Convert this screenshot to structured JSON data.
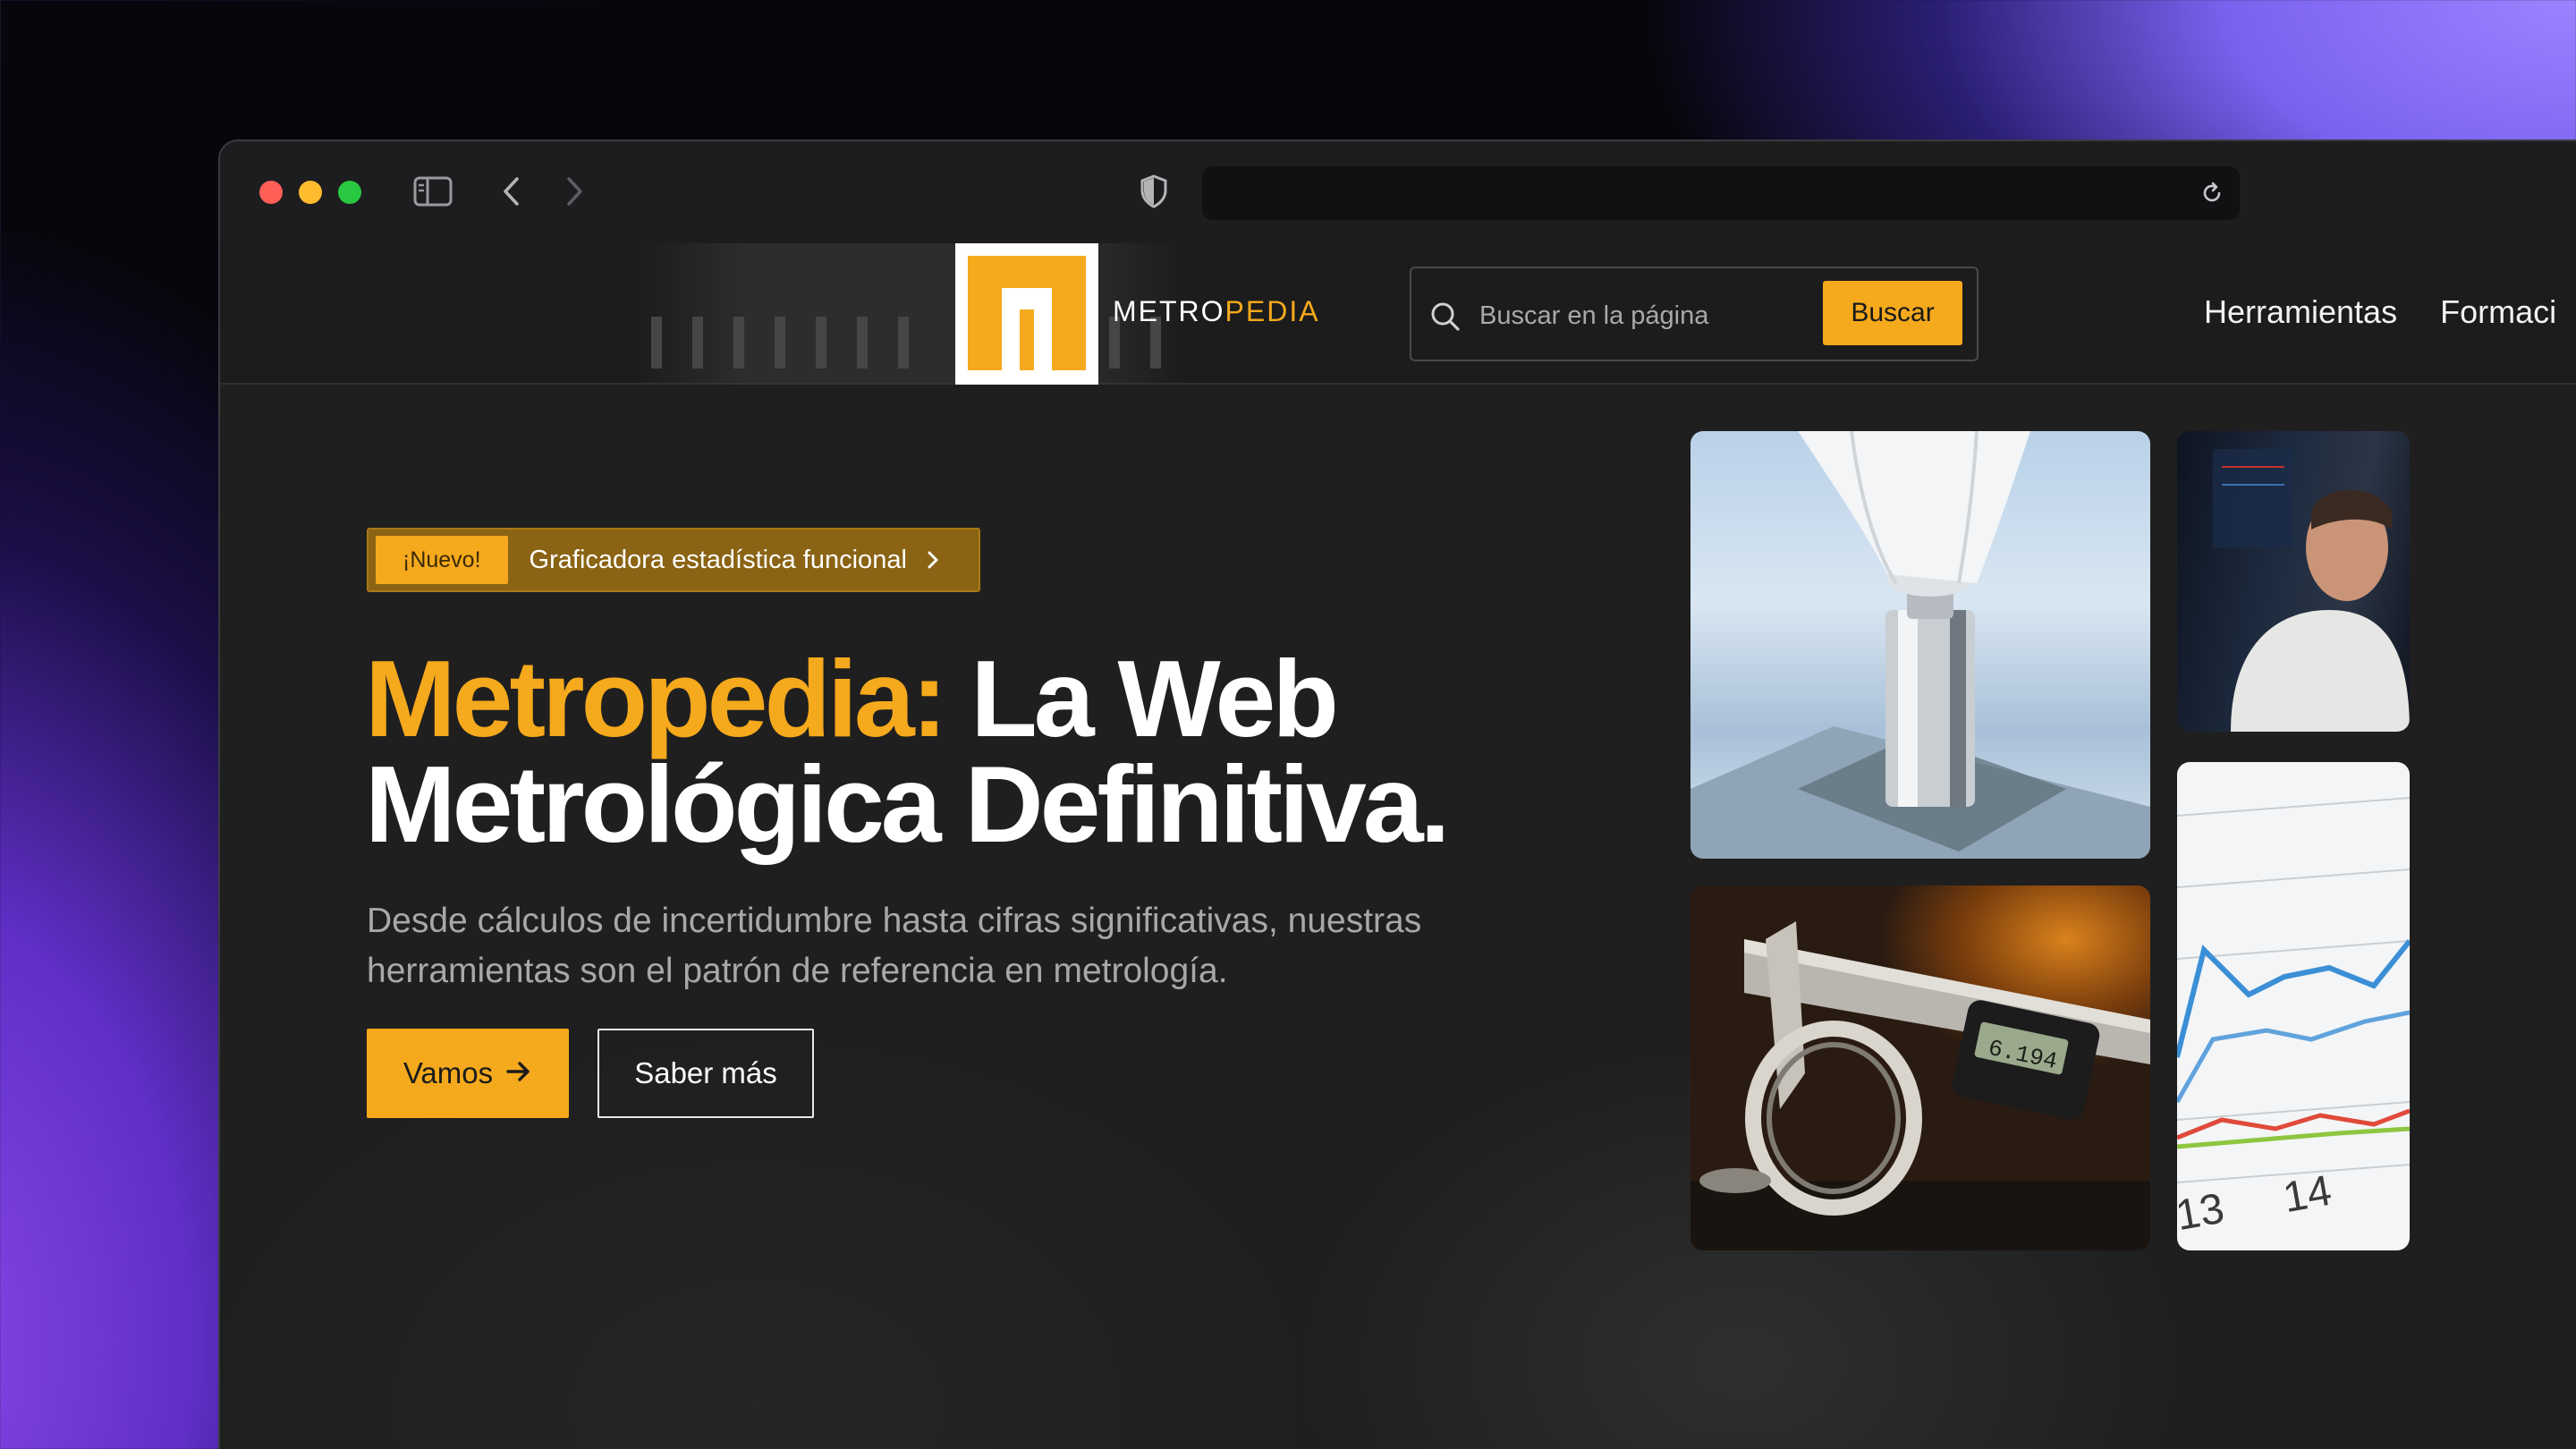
{
  "browser": {
    "url": ""
  },
  "site": {
    "logo_text_main": "METRO",
    "logo_text_accent": "PEDIA",
    "search": {
      "placeholder": "Buscar en la página",
      "button_label": "Buscar"
    },
    "nav": [
      {
        "label": "Herramientas"
      },
      {
        "label": "Formaci"
      }
    ]
  },
  "hero": {
    "badge": "¡Nuevo!",
    "announcement": "Graficadora estadística funcional",
    "title_brand": "Metropedia:",
    "title_line1_rest": " La Web",
    "title_line2": "Metrológica Definitiva.",
    "subtitle": "Desde cálculos de incertidumbre hasta cifras significativas, nuestras herramientas son el patrón de referencia en metrología.",
    "primary_button": "Vamos",
    "secondary_button": "Saber más"
  },
  "images": {
    "caliper_display": "6.194",
    "chart_ticks": [
      "13",
      "14"
    ]
  },
  "colors": {
    "accent": "#f5a91c",
    "page_bg": "#1f1f1f",
    "header_bg": "#1c1c1c"
  },
  "icons": [
    "sidebar-icon",
    "chevron-left-icon",
    "chevron-right-icon",
    "shield-icon",
    "reload-icon",
    "search-icon",
    "chevron-right-icon",
    "arrow-right-icon"
  ]
}
